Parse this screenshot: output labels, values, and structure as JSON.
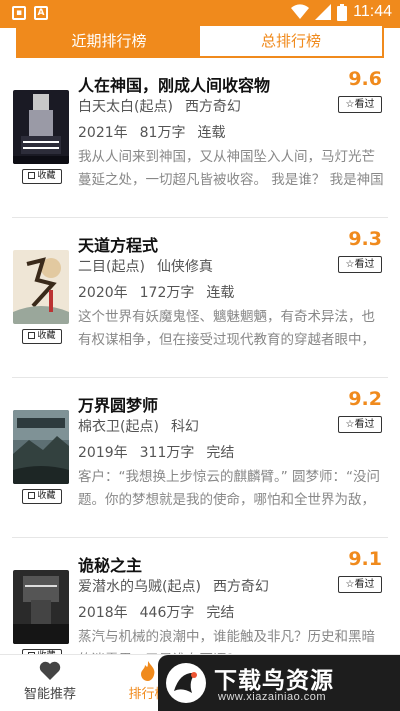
{
  "status_bar": {
    "time": "11:44",
    "left_icons": [
      "image-notification-icon",
      "text-notification-icon"
    ],
    "right_icons": [
      "wifi-icon",
      "signal-icon",
      "battery-icon"
    ]
  },
  "tabs": [
    {
      "label": "近期排行榜",
      "active": true
    },
    {
      "label": "总排行榜",
      "active": false
    }
  ],
  "books": [
    {
      "title": "人在神国，刚成人间收容物",
      "author": "白天太白(起点)",
      "genre": "西方奇幻",
      "year": "2021年",
      "words": "81万字",
      "status": "连载",
      "score": "9.6",
      "read_label": "看过",
      "fav_label": "收藏",
      "description": "我从人间来到神国，又从神国坠入人间，马灯光芒蔓延之处，一切超凡皆被收容。 我是谁？ 我是神国子民排斥敬畏的黑瞳异族；"
    },
    {
      "title": "天道方程式",
      "author": "二目(起点)",
      "genre": "仙侠修真",
      "year": "2020年",
      "words": "172万字",
      "status": "连载",
      "score": "9.3",
      "read_label": "看过",
      "fav_label": "收藏",
      "description": "这个世界有妖魔鬼怪、魑魅魍魉，有奇术异法，也有权谋相争，但在接受过现代教育的穿越者眼中，探索未知永远摆在第一位！（正..."
    },
    {
      "title": "万界圆梦师",
      "author": "棉衣卫(起点)",
      "genre": "科幻",
      "year": "2019年",
      "words": "311万字",
      "status": "完结",
      "score": "9.2",
      "read_label": "看过",
      "fav_label": "收藏",
      "description": "客户：“我想换上步惊云的麒麟臂。” 圆梦师：“没问题。你的梦想就是我的使命，哪怕和全世界为敌，我们也会帮你实现。” 客..."
    },
    {
      "title": "诡秘之主",
      "author": "爱潜水的乌贼(起点)",
      "genre": "西方奇幻",
      "year": "2018年",
      "words": "446万字",
      "status": "完结",
      "score": "9.1",
      "read_label": "看过",
      "fav_label": "收藏",
      "description": "蒸汽与机械的浪潮中，谁能触及非凡？历史和黑暗的迷雾里，又是谁在耳语？"
    }
  ],
  "bottom_nav": [
    {
      "label": "智能推荐",
      "icon": "heart-icon",
      "active": false
    },
    {
      "label": "排行榜",
      "icon": "flame-icon",
      "active": true
    }
  ],
  "watermark": {
    "text": "下载鸟资源",
    "url": "www.xiazainiao.com"
  },
  "colors": {
    "accent": "#f08a1c",
    "text": "#222222",
    "muted": "#888888"
  }
}
